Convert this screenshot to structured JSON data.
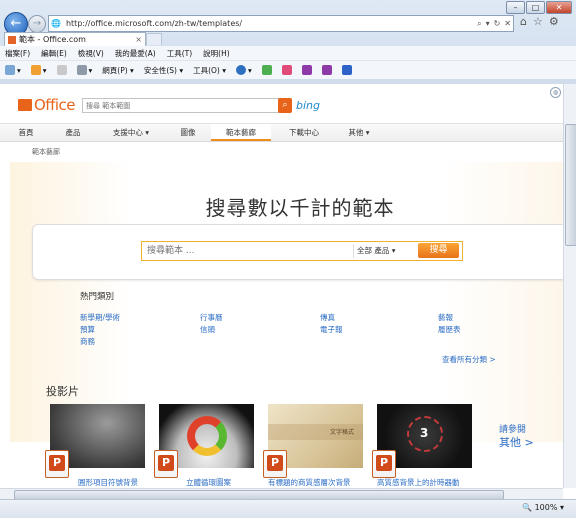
{
  "window": {
    "controls": [
      "minimize",
      "maximize",
      "close"
    ]
  },
  "browser": {
    "url": "http://office.microsoft.com/zh-tw/templates/",
    "tab_title": "範本 - Office.com",
    "menu": [
      "檔案(F)",
      "編輯(E)",
      "檢視(V)",
      "我的最愛(A)",
      "工具(T)",
      "說明(H)"
    ],
    "commands": [
      "網頁(P) ▾",
      "安全性(S) ▾",
      "工具(O) ▾"
    ],
    "zoom": "100%"
  },
  "header": {
    "logo_text": "Office",
    "search_placeholder": "搜尋 範本範圍",
    "bing_label": "bing"
  },
  "nav": {
    "tabs": [
      "首頁",
      "產品",
      "支援中心 ▾",
      "圖像",
      "範本藝廊",
      "下載中心",
      "其他 ▾"
    ],
    "selected_index": 4
  },
  "breadcrumb": "範本藝廊",
  "hero": {
    "title": "搜尋數以千計的範本",
    "search_placeholder": "搜尋範本 ...",
    "dropdown_label": "全部 產品",
    "search_button": "搜尋"
  },
  "categories": {
    "heading": "熱門類別",
    "items": [
      [
        "新學期/學術",
        "預算",
        "商務"
      ],
      [
        "行事曆",
        "信頭"
      ],
      [
        "傳真",
        "電子報"
      ],
      [
        "藝報",
        "履歷表"
      ]
    ],
    "see_all": "查看所有分類 >"
  },
  "slides": {
    "heading": "投影片",
    "items": [
      {
        "label": "圓形項目符號背景"
      },
      {
        "label": "立體循環圖案"
      },
      {
        "label": "有標題的商質感層次背景"
      },
      {
        "label": "高質感背景上的計時器動"
      }
    ],
    "thumb_caption": "文字格式",
    "thumb_numeral": "3",
    "see_more_1": "請參閱",
    "see_more_2": "其他 >"
  },
  "colors": {
    "accent_orange": "#e8641b",
    "link_blue": "#2a6cc4",
    "nav_selected": "#f08c1a"
  }
}
